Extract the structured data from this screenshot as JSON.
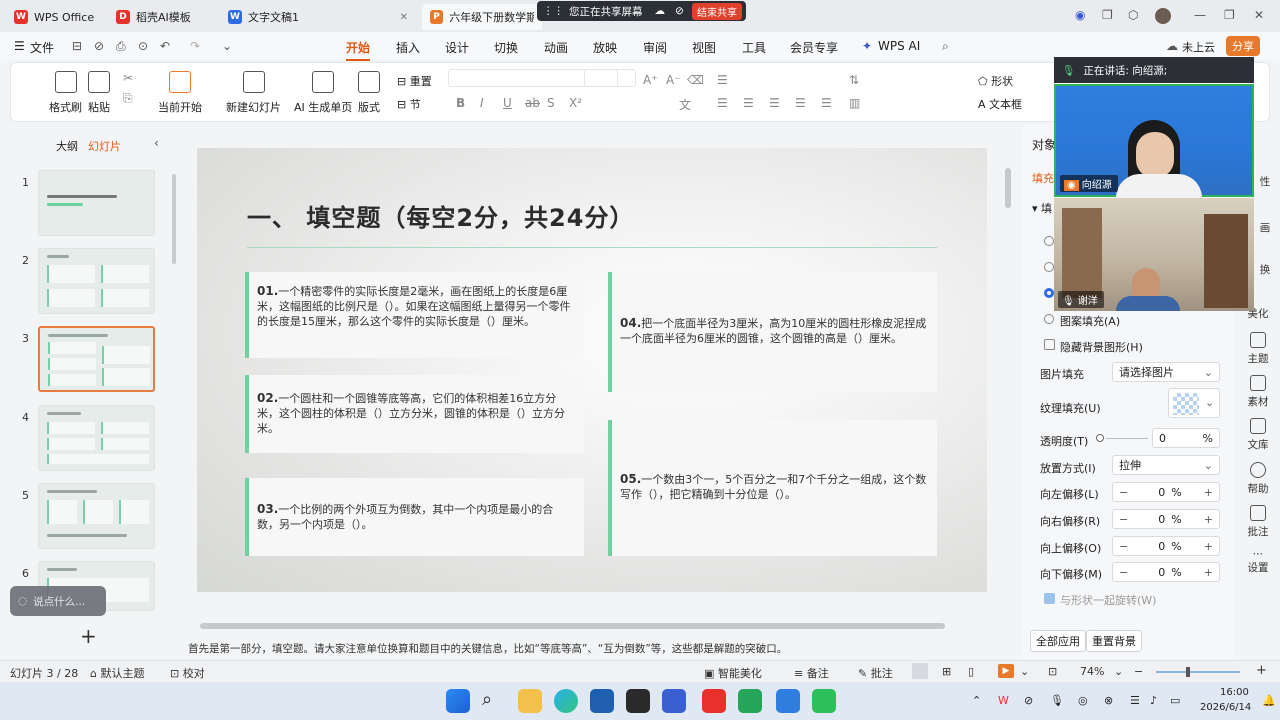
{
  "tabs": [
    {
      "label": "WPS Office"
    },
    {
      "label": "稻壳AI模板"
    },
    {
      "label": "文字文稿1"
    },
    {
      "label": "六年级下册数学期末"
    }
  ],
  "share_bar": {
    "text": "您正在共享屏幕",
    "stop_label": "结束共享"
  },
  "menubar": {
    "file": "文件",
    "items": [
      "开始",
      "插入",
      "设计",
      "切换",
      "动画",
      "放映",
      "审阅",
      "视图",
      "工具",
      "会员专享",
      "WPS AI"
    ],
    "cloud": "未上云",
    "share": "分享"
  },
  "ribbon": {
    "format_painter": "格式刷",
    "paste": "粘贴",
    "from_current": "当前开始",
    "new_slide": "新建幻灯片",
    "ai_page": "AI 生成单页",
    "layout": "版式",
    "reset": "重置",
    "section": "节",
    "shape": "形状",
    "textbox": "文本框"
  },
  "leftpanel": {
    "outline_tab": "大纲",
    "slides_tab": "幻灯片",
    "search_placeholder": "说点什么..."
  },
  "slide": {
    "title": "一、 填空题（每空2分，共24分）",
    "questions": [
      {
        "num": "01.",
        "text": "一个精密零件的实际长度是2毫米，画在图纸上的长度是6厘米，这幅图纸的比例尺是（）。如果在这幅图纸上量得另一个零件的长度是15厘米，那么这个零件的实际长度是（）厘米。"
      },
      {
        "num": "02.",
        "text": "一个圆柱和一个圆锥等底等高，它们的体积相差16立方分米，这个圆柱的体积是（）立方分米，圆锥的体积是（）立方分米。"
      },
      {
        "num": "03.",
        "text": "一个比例的两个外项互为倒数，其中一个内项是最小的合数，另一个内项是（）。"
      },
      {
        "num": "04.",
        "text": "把一个底面半径为3厘米，高为10厘米的圆柱形橡皮泥捏成一个底面半径为6厘米的圆锥，这个圆锥的高是（）厘米。"
      },
      {
        "num": "05.",
        "text": "一个数由3个一，5个百分之一和7个千分之一组成，这个数写作（），把它精确到十分位是（）。"
      }
    ]
  },
  "notes": "首先是第一部分，填空题。请大家注意单位换算和题目中的关键信息，比如“等底等高”、“互为倒数”等，这些都是解题的突破口。",
  "status": {
    "slide_counter": "幻灯片 3 / 28",
    "theme": "默认主题",
    "proofread": "校对",
    "beautify": "智能美化",
    "notes_btn": "备注",
    "comment_btn": "批注",
    "zoom": "74%"
  },
  "rightpanel": {
    "title_partial": "对象",
    "fill_tab": "填充",
    "fill_partial": "填",
    "pattern_fill": "图案填充(A)",
    "hide_bg": "隐藏背景图形(H)",
    "picture_fill_label": "图片填充",
    "picture_fill_value": "请选择图片",
    "texture_label": "纹理填充(U)",
    "transparency_label": "透明度(T)",
    "transparency_value": "0",
    "transparency_unit": "%",
    "placement_label": "放置方式(I)",
    "placement_value": "拉伸",
    "offset_left_label": "向左偏移(L)",
    "offset_right_label": "向右偏移(R)",
    "offset_up_label": "向上偏移(O)",
    "offset_down_label": "向下偏移(M)",
    "offset_value": "0",
    "offset_unit": "%",
    "rotate_with_shape": "与形状一起旋转(W)",
    "apply_all": "全部应用",
    "reset_bg": "重置背景"
  },
  "sidetools": [
    "属性",
    "动画",
    "切换",
    "美化",
    "主题",
    "素材",
    "文库",
    "帮助",
    "批注",
    "设置"
  ],
  "sidetools_partial": [
    "性",
    "画",
    "换",
    "美化"
  ],
  "video": {
    "speaking_text": "正在讲话:  向绍源;",
    "person1": "向绍源",
    "person2": "谢洋"
  },
  "taskbar": {
    "time": "16:00",
    "date": "2026/6/14"
  }
}
